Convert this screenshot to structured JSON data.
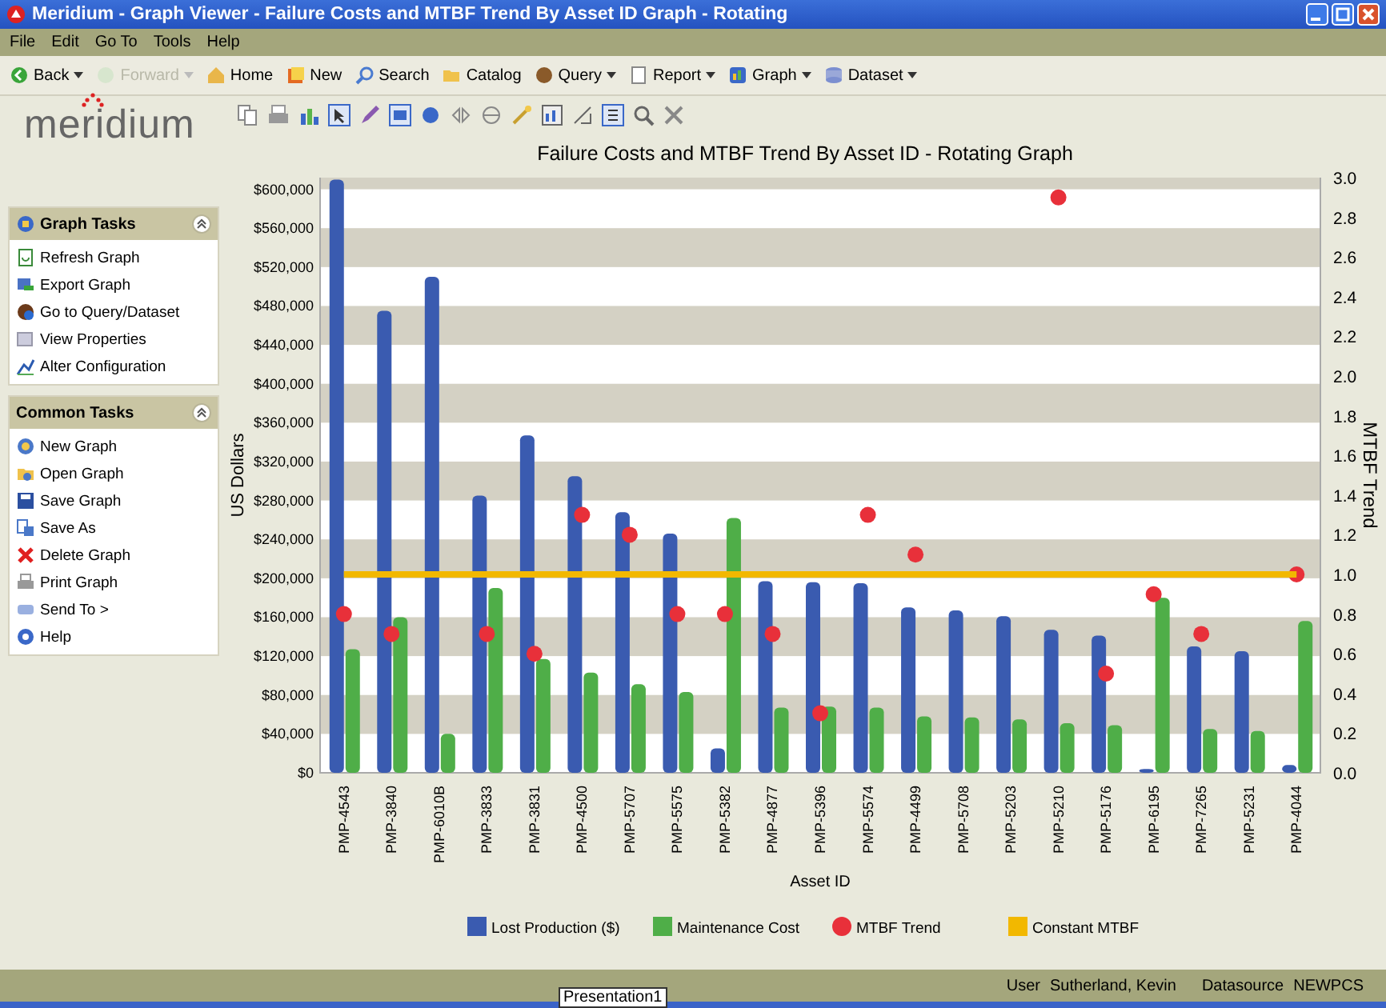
{
  "window": {
    "title": "Meridium - Graph Viewer - Failure Costs and MTBF Trend By Asset ID Graph - Rotating"
  },
  "menu": [
    "File",
    "Edit",
    "Go To",
    "Tools",
    "Help"
  ],
  "nav_toolbar": [
    {
      "label": "Back",
      "dropdown": true,
      "disabled": false
    },
    {
      "label": "Forward",
      "dropdown": true,
      "disabled": true
    },
    {
      "label": "Home",
      "dropdown": false,
      "disabled": false
    },
    {
      "label": "New",
      "dropdown": false,
      "disabled": false
    },
    {
      "label": "Search",
      "dropdown": false,
      "disabled": false
    },
    {
      "label": "Catalog",
      "dropdown": false,
      "disabled": false
    },
    {
      "label": "Query",
      "dropdown": true,
      "disabled": false
    },
    {
      "label": "Report",
      "dropdown": true,
      "disabled": false
    },
    {
      "label": "Graph",
      "dropdown": true,
      "disabled": false
    },
    {
      "label": "Dataset",
      "dropdown": true,
      "disabled": false
    }
  ],
  "logo": "meridium",
  "sidebar": {
    "panels": [
      {
        "title": "Graph Tasks",
        "expanded": true,
        "items": [
          "Refresh Graph",
          "Export Graph",
          "Go to Query/Dataset",
          "View Properties",
          "Alter Configuration"
        ]
      },
      {
        "title": "Common Tasks",
        "expanded": true,
        "items": [
          "New Graph",
          "Open Graph",
          "Save Graph",
          "Save As",
          "Delete Graph",
          "Print Graph",
          "Send To >",
          "Help"
        ]
      }
    ]
  },
  "graph": {
    "chart_data": {
      "type": "bar",
      "title": "Failure Costs and MTBF Trend By Asset ID - Rotating Graph",
      "xlabel": "Asset ID",
      "ylabel": "US Dollars",
      "y2label": "MTBF Trend",
      "categories": [
        "PMP-4543",
        "PMP-3840",
        "PMP-6010B",
        "PMP-3833",
        "PMP-3831",
        "PMP-4500",
        "PMP-5707",
        "PMP-5575",
        "PMP-5382",
        "PMP-4877",
        "PMP-5396",
        "PMP-5574",
        "PMP-4499",
        "PMP-5708",
        "PMP-5203",
        "PMP-5210",
        "PMP-5176",
        "PMP-6195",
        "PMP-7265",
        "PMP-5231",
        "PMP-4044"
      ],
      "series": [
        {
          "name": "Lost Production ($)",
          "color": "#3a5bb0",
          "values": [
            610000,
            475000,
            510000,
            285000,
            347000,
            305000,
            268000,
            246000,
            25000,
            197000,
            196000,
            195000,
            170000,
            167000,
            161000,
            147000,
            141000,
            4000,
            130000,
            125000,
            8000
          ]
        },
        {
          "name": "Maintenance Cost",
          "color": "#4fae48",
          "values": [
            127000,
            160000,
            40000,
            190000,
            117000,
            103000,
            91000,
            83000,
            262000,
            67000,
            68000,
            67000,
            58000,
            57000,
            55000,
            51000,
            49000,
            180000,
            45000,
            43000,
            156000
          ]
        },
        {
          "name": "MTBF Trend",
          "type": "scatter",
          "axis": "y2",
          "color": "#e8303a",
          "values": [
            0.8,
            0.7,
            null,
            0.7,
            0.6,
            1.3,
            1.2,
            0.8,
            0.8,
            0.7,
            0.3,
            1.3,
            1.1,
            null,
            null,
            2.9,
            0.5,
            0.9,
            0.7,
            null,
            1.0
          ]
        },
        {
          "name": "Constant MTBF",
          "type": "line",
          "axis": "y2",
          "color": "#f2b800",
          "values": [
            1.0,
            1.0,
            1.0,
            1.0,
            1.0,
            1.0,
            1.0,
            1.0,
            1.0,
            1.0,
            1.0,
            1.0,
            1.0,
            1.0,
            1.0,
            1.0,
            1.0,
            1.0,
            1.0,
            1.0,
            1.0
          ]
        }
      ],
      "legend": true,
      "ylim": [
        0,
        612000
      ],
      "y2lim": [
        0,
        3
      ],
      "yticks": [
        {
          "value": 0,
          "label": "$0"
        },
        {
          "value": 40000,
          "label": "$40,000"
        },
        {
          "value": 80000,
          "label": "$80,000"
        },
        {
          "value": 120000,
          "label": "$120,000"
        },
        {
          "value": 160000,
          "label": "$160,000"
        },
        {
          "value": 200000,
          "label": "$200,000"
        },
        {
          "value": 240000,
          "label": "$240,000"
        },
        {
          "value": 280000,
          "label": "$280,000"
        },
        {
          "value": 320000,
          "label": "$320,000"
        },
        {
          "value": 360000,
          "label": "$360,000"
        },
        {
          "value": 400000,
          "label": "$400,000"
        },
        {
          "value": 440000,
          "label": "$440,000"
        },
        {
          "value": 480000,
          "label": "$480,000"
        },
        {
          "value": 520000,
          "label": "$520,000"
        },
        {
          "value": 560000,
          "label": "$560,000"
        },
        {
          "value": 600000,
          "label": "$600,000"
        }
      ],
      "y2ticks": [
        {
          "value": 0,
          "label": "0.0"
        },
        {
          "value": 0.2,
          "label": "0.2"
        },
        {
          "value": 0.4,
          "label": "0.4"
        },
        {
          "value": 0.6,
          "label": "0.6"
        },
        {
          "value": 0.8,
          "label": "0.8"
        },
        {
          "value": 1,
          "label": "1.0"
        },
        {
          "value": 1.2,
          "label": "1.2"
        },
        {
          "value": 1.4,
          "label": "1.4"
        },
        {
          "value": 1.6,
          "label": "1.6"
        },
        {
          "value": 1.8,
          "label": "1.8"
        },
        {
          "value": 2,
          "label": "2.0"
        },
        {
          "value": 2.2,
          "label": "2.2"
        },
        {
          "value": 2.4,
          "label": "2.4"
        },
        {
          "value": 2.6,
          "label": "2.6"
        },
        {
          "value": 2.8,
          "label": "2.8"
        },
        {
          "value": 3,
          "label": "3.0"
        }
      ]
    }
  },
  "status_bar": {
    "tooltip": "Presentation1",
    "fields": [
      {
        "label": "User",
        "value": "Sutherland, Kevin"
      },
      {
        "label": "Datasource",
        "value": "NEWPCS"
      }
    ]
  }
}
